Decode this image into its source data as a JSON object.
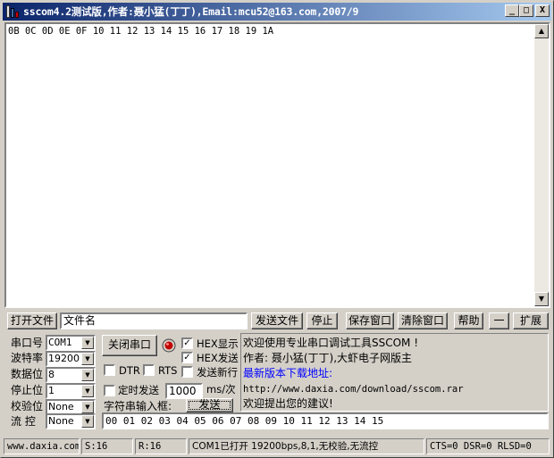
{
  "title": "sscom4.2测试版,作者:聂小猛(丁丁),Email:mcu52@163.com,2007/9",
  "titlebar_buttons": {
    "minimize": "_",
    "maximize": "□",
    "close": "X"
  },
  "receive_text": "0B 0C 0D 0E 0F 10 11 12 13 14 15 16 17 18 19 1A",
  "file_row": {
    "open_file": "打开文件",
    "filename": "文件名",
    "send_file": "发送文件",
    "stop": "停止",
    "save_window": "保存窗口",
    "clear_window": "清除窗口",
    "help": "帮助",
    "dash": "一",
    "expand": "扩展"
  },
  "serial": {
    "port_label": "串口号",
    "port_value": "COM1",
    "baud_label": "波特率",
    "baud_value": "19200",
    "data_label": "数据位",
    "data_value": "8",
    "stop_label": "停止位",
    "stop_value": "1",
    "parity_label": "校验位",
    "parity_value": "None",
    "flow_label": "流 控",
    "flow_value": "None"
  },
  "controls": {
    "close_port": "关闭串口",
    "hex_display": "HEX显示",
    "hex_send": "HEX发送",
    "dtr": "DTR",
    "rts": "RTS",
    "send_newline": "发送新行",
    "timed_send": "定时发送",
    "interval_value": "1000",
    "interval_unit": "ms/次",
    "input_label": "字符串输入框:",
    "send_button": "发送",
    "send_input": "00 01 02 03 04 05 06 07 08 09 10 11 12 13 14 15"
  },
  "info": {
    "line1": "欢迎使用专业串口调试工具SSCOM !",
    "line2": "作者: 聂小猛(丁丁),大虾电子网版主",
    "line3": "最新版本下载地址:",
    "line4": "http://www.daxia.com/download/sscom.rar",
    "line5": "欢迎提出您的建议!"
  },
  "status_bar": {
    "site": "www.daxia.com",
    "sent": "S:16",
    "received": "R:16",
    "port_state": "COM1已打开  19200bps,8,1,无校验,无流控",
    "signals": "CTS=0 DSR=0 RLSD=0"
  },
  "colors": {
    "link": "#0000ff",
    "indicator": "#c00000"
  }
}
